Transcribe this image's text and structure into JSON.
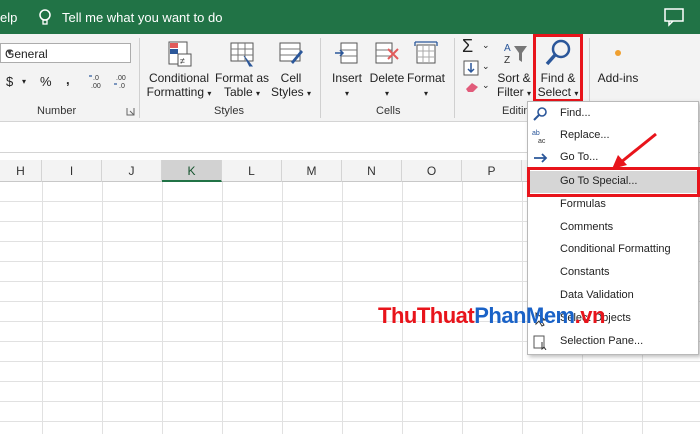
{
  "titlebar": {
    "help": "elp",
    "tell_me": "Tell me what you want to do",
    "accent": "#217346"
  },
  "ribbon": {
    "number_format": "General",
    "groups": {
      "number": "Number",
      "styles": "Styles",
      "cells": "Cells",
      "editing": "Editin"
    },
    "buttons": {
      "currency": "$",
      "percent": "%",
      "comma": ",",
      "conditional_formatting": [
        "Conditional",
        "Formatting"
      ],
      "format_as_table": [
        "Format as",
        "Table"
      ],
      "cell_styles": [
        "Cell",
        "Styles"
      ],
      "insert": "Insert",
      "delete": "Delete",
      "format": "Format",
      "sort_filter": [
        "Sort &",
        "Filter"
      ],
      "find_select": [
        "Find &",
        "Select"
      ],
      "addins": "Add-ins"
    }
  },
  "columns": [
    "H",
    "I",
    "J",
    "K",
    "L",
    "M",
    "N",
    "O",
    "P"
  ],
  "selected_column": "K",
  "menu": {
    "items": [
      {
        "label": "Find...",
        "icon": "find-icon"
      },
      {
        "label": "Replace...",
        "icon": "replace-icon"
      },
      {
        "label": "Go To...",
        "icon": "goto-arrow-icon"
      },
      {
        "label": "Go To Special...",
        "icon": ""
      },
      {
        "label": "Formulas",
        "icon": ""
      },
      {
        "label": "Comments",
        "icon": ""
      },
      {
        "label": "Conditional Formatting",
        "icon": ""
      },
      {
        "label": "Constants",
        "icon": ""
      },
      {
        "label": "Data Validation",
        "icon": ""
      },
      {
        "label": "Select Objects",
        "icon": "select-objects-icon"
      },
      {
        "label": "Selection Pane...",
        "icon": "selection-pane-icon"
      }
    ],
    "highlighted": "Go To Special..."
  },
  "watermark": {
    "part1": "ThuThuat",
    "part2": "PhanMem",
    "part3": ".vn"
  },
  "colors": {
    "highlight_red": "#e8141b",
    "excel_green": "#217346"
  }
}
